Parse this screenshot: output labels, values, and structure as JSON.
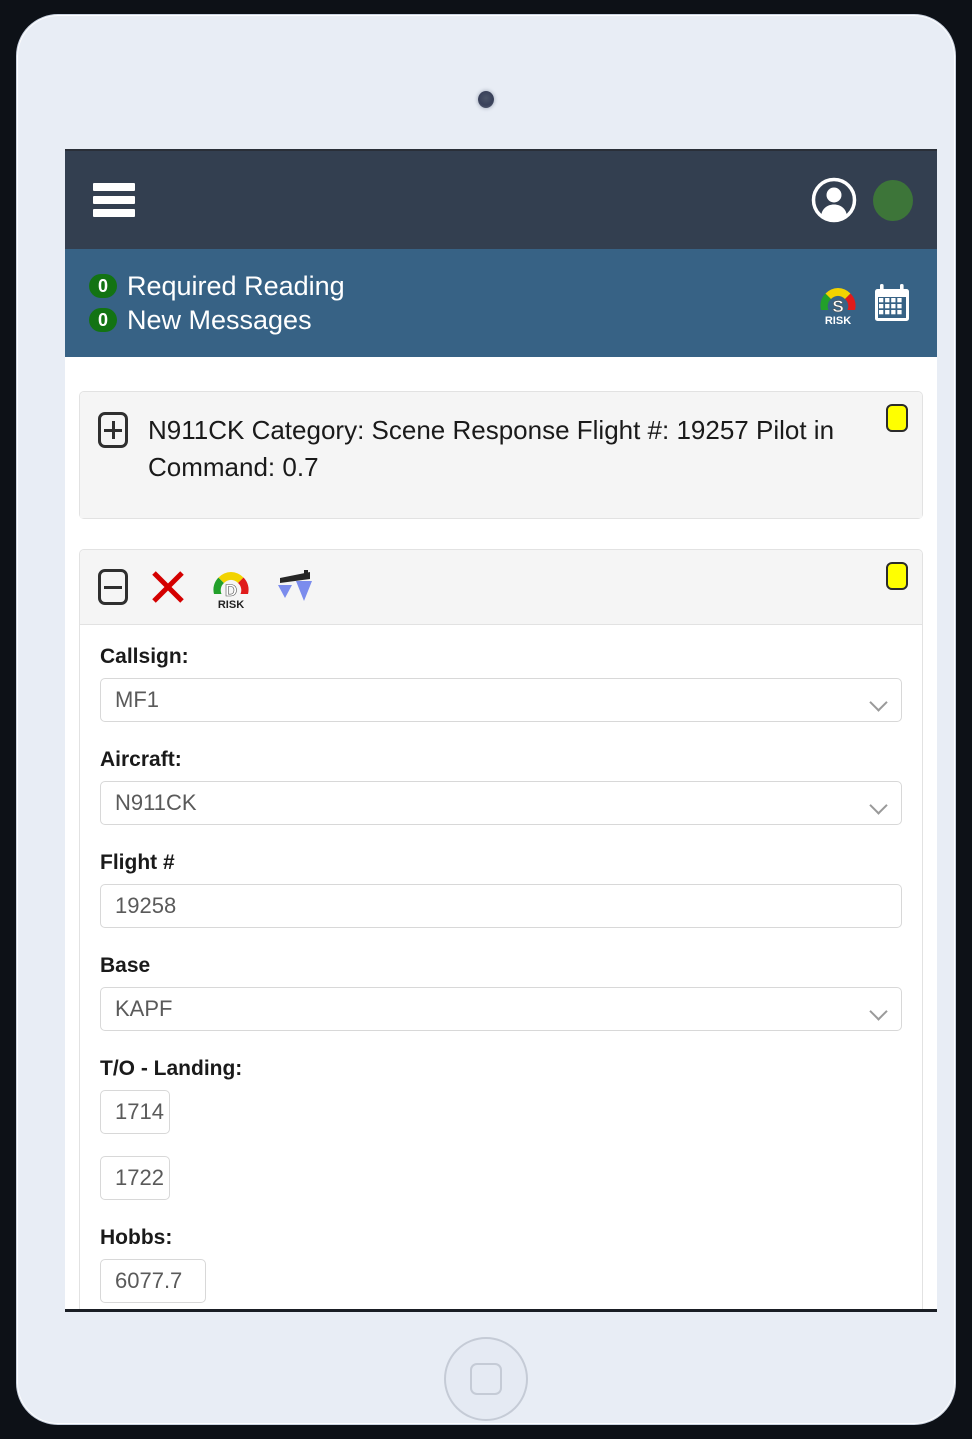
{
  "device": {
    "camera_icon": "camera-dot",
    "home_button_icon": "home-button-square"
  },
  "top_bar": {
    "menu_icon": "hamburger-icon",
    "avatar_icon": "user-avatar-icon",
    "status_dot_color": "#3d7539",
    "background_color": "#333f50"
  },
  "notification_bar": {
    "background_color": "#376285",
    "items": [
      {
        "count": "0",
        "label": "Required Reading"
      },
      {
        "count": "0",
        "label": "New Messages"
      }
    ],
    "icons": [
      {
        "name": "risk-gauge-icon",
        "letter": "S",
        "sublabel": "RISK"
      },
      {
        "name": "calendar-icon"
      }
    ]
  },
  "panels": [
    {
      "collapsed": true,
      "toggle_icon": "expand-plus-icon",
      "title": "N911CK Category: Scene Response Flight #: 19257 Pilot in Command: 0.7",
      "status_chip_color": "#ffff00"
    },
    {
      "collapsed": false,
      "toggle_icon": "collapse-minus-icon",
      "status_chip_color": "#ffff00",
      "actions": [
        {
          "name": "delete-x-icon"
        },
        {
          "name": "risk-gauge-icon",
          "letter": "D",
          "sublabel": "RISK"
        },
        {
          "name": "weight-balance-scale-icon"
        }
      ],
      "form": {
        "fields": [
          {
            "label": "Callsign:",
            "value": "MF1",
            "type": "select",
            "name": "callsign"
          },
          {
            "label": "Aircraft:",
            "value": "N911CK",
            "type": "select",
            "name": "aircraft"
          },
          {
            "label": "Flight #",
            "value": "19258",
            "type": "text",
            "name": "flight-number"
          },
          {
            "label": "Base",
            "value": "KAPF",
            "type": "select",
            "name": "base"
          }
        ],
        "takeoff_landing": {
          "label": "T/O - Landing:",
          "takeoff": "1714",
          "landing": "1722"
        },
        "hobbs": {
          "label": "Hobbs:",
          "value": "6077.7"
        }
      }
    }
  ]
}
